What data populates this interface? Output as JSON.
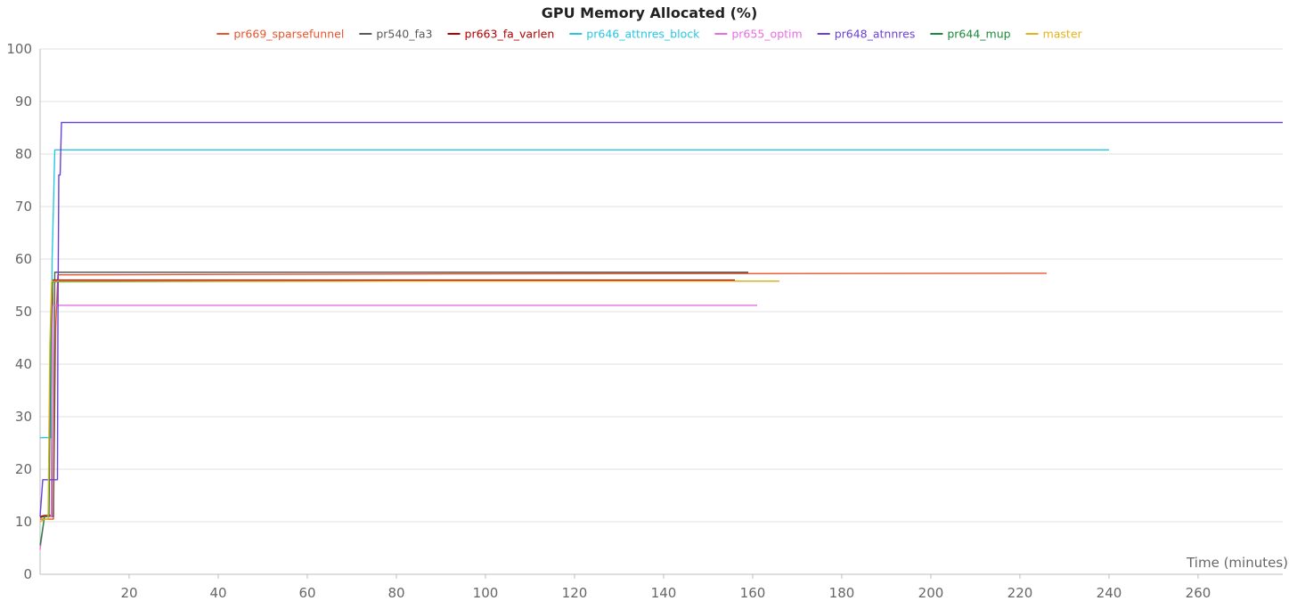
{
  "chart_data": {
    "type": "line",
    "title": "GPU Memory Allocated (%)",
    "xlabel": "Time (minutes)",
    "ylabel": "",
    "xlim": [
      0,
      279
    ],
    "ylim": [
      0,
      100
    ],
    "xticks": [
      20,
      40,
      60,
      80,
      100,
      120,
      140,
      160,
      180,
      200,
      220,
      240,
      260
    ],
    "yticks": [
      0,
      10,
      20,
      30,
      40,
      50,
      60,
      70,
      80,
      90,
      100
    ],
    "grid": true,
    "legend_position": "top",
    "series": [
      {
        "name": "pr669_sparsefunnel",
        "color": "#e8542d",
        "points": [
          [
            0,
            10.5
          ],
          [
            1,
            10.5
          ],
          [
            2,
            10.5
          ],
          [
            2.5,
            10.5
          ],
          [
            3,
            10.5
          ],
          [
            3.5,
            47
          ],
          [
            4,
            57
          ],
          [
            100,
            57.2
          ],
          [
            226,
            57.3
          ]
        ]
      },
      {
        "name": "pr540_fa3",
        "color": "#5a5a5a",
        "points": [
          [
            0,
            10.8
          ],
          [
            1,
            11
          ],
          [
            2,
            11
          ],
          [
            3,
            11
          ],
          [
            3.3,
            57.5
          ],
          [
            80,
            57.5
          ],
          [
            159,
            57.5
          ]
        ]
      },
      {
        "name": "pr663_fa_varlen",
        "color": "#b30000",
        "points": [
          [
            0,
            11
          ],
          [
            1,
            11.2
          ],
          [
            2,
            11.2
          ],
          [
            2.6,
            11.2
          ],
          [
            2.8,
            56
          ],
          [
            80,
            56
          ],
          [
            156,
            56
          ]
        ]
      },
      {
        "name": "pr646_attnres_block",
        "color": "#29c6e3",
        "points": [
          [
            0,
            26
          ],
          [
            1,
            26
          ],
          [
            2,
            26
          ],
          [
            2.4,
            26
          ],
          [
            2.7,
            60
          ],
          [
            3,
            70
          ],
          [
            3.3,
            80.8
          ],
          [
            120,
            80.8
          ],
          [
            240,
            80.8
          ]
        ]
      },
      {
        "name": "pr655_optim",
        "color": "#e86de2",
        "points": [
          [
            0,
            4.7
          ],
          [
            1,
            11
          ],
          [
            2,
            11
          ],
          [
            2.5,
            11
          ],
          [
            2.8,
            51.2
          ],
          [
            80,
            51.2
          ],
          [
            161,
            51.2
          ]
        ]
      },
      {
        "name": "pr648_atnnres",
        "color": "#6a3fd6",
        "points": [
          [
            0,
            11
          ],
          [
            0.6,
            18
          ],
          [
            1.5,
            18
          ],
          [
            3,
            18
          ],
          [
            3.9,
            18
          ],
          [
            4,
            47
          ],
          [
            4.2,
            76
          ],
          [
            4.5,
            76
          ],
          [
            4.8,
            86
          ],
          [
            279,
            86
          ]
        ]
      },
      {
        "name": "pr644_mup",
        "color": "#1a8a3c",
        "points": [
          [
            0,
            5.5
          ],
          [
            1,
            11
          ],
          [
            2,
            11
          ],
          [
            2.4,
            46
          ],
          [
            2.8,
            55.7
          ],
          [
            80,
            55.8
          ],
          [
            166,
            55.8
          ]
        ]
      },
      {
        "name": "master",
        "color": "#e3b31c",
        "points": [
          [
            0,
            10
          ],
          [
            1,
            10.5
          ],
          [
            1.8,
            10.5
          ],
          [
            2.2,
            44
          ],
          [
            2.6,
            55.8
          ],
          [
            80,
            55.8
          ],
          [
            166,
            55.8
          ]
        ]
      }
    ]
  }
}
